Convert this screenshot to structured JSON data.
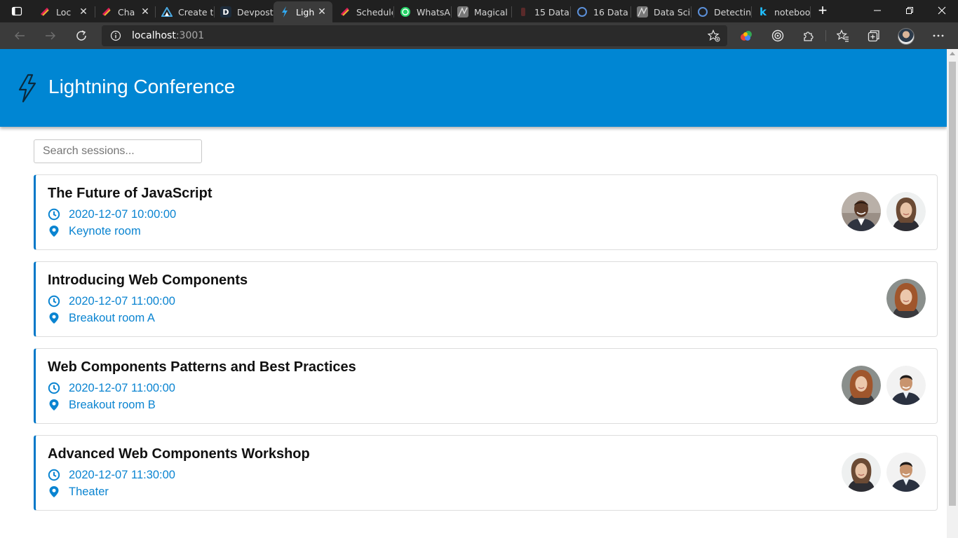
{
  "browser": {
    "tabs": [
      {
        "title": "Loc",
        "favicon": "slack-icon",
        "active": false,
        "closable": true
      },
      {
        "title": "Cha",
        "favicon": "slack-icon",
        "active": false,
        "closable": true
      },
      {
        "title": "Create th",
        "favicon": "azure-icon",
        "active": false,
        "closable": false
      },
      {
        "title": "Devpost",
        "favicon": "devpost-icon",
        "active": false,
        "closable": false
      },
      {
        "title": "Ligh",
        "favicon": "lightning-icon",
        "active": true,
        "closable": true
      },
      {
        "title": "Schedule",
        "favicon": "slack-icon",
        "active": false,
        "closable": false
      },
      {
        "title": "WhatsAp",
        "favicon": "whatsapp-icon",
        "active": false,
        "closable": false
      },
      {
        "title": "Magical",
        "favicon": "article-icon",
        "active": false,
        "closable": false
      },
      {
        "title": "15 Data",
        "favicon": "bookmark-icon",
        "active": false,
        "closable": false
      },
      {
        "title": "16 Data",
        "favicon": "blog-icon",
        "active": false,
        "closable": false
      },
      {
        "title": "Data Scie",
        "favicon": "article-icon",
        "active": false,
        "closable": false
      },
      {
        "title": "Detectin",
        "favicon": "blog-icon",
        "active": false,
        "closable": false
      },
      {
        "title": "noteboo",
        "favicon": "kaggle-icon",
        "active": false,
        "closable": false
      }
    ],
    "address": {
      "host": "localhost",
      "port": ":3001"
    }
  },
  "app": {
    "title": "Lightning Conference",
    "accent": "#0086d3",
    "search_placeholder": "Search sessions...",
    "sessions": [
      {
        "title": "The Future of JavaScript",
        "datetime": "2020-12-07 10:00:00",
        "room": "Keynote room",
        "speakers": [
          "speaker-man-smiling",
          "speaker-woman-brown-hair"
        ]
      },
      {
        "title": "Introducing Web Components",
        "datetime": "2020-12-07 11:00:00",
        "room": "Breakout room A",
        "speakers": [
          "speaker-woman-red-hair"
        ]
      },
      {
        "title": "Web Components Patterns and Best Practices",
        "datetime": "2020-12-07 11:00:00",
        "room": "Breakout room B",
        "speakers": [
          "speaker-woman-red-hair",
          "speaker-man-suit"
        ]
      },
      {
        "title": "Advanced Web Components Workshop",
        "datetime": "2020-12-07 11:30:00",
        "room": "Theater",
        "speakers": [
          "speaker-woman-brown-hair",
          "speaker-man-suit"
        ]
      }
    ]
  }
}
